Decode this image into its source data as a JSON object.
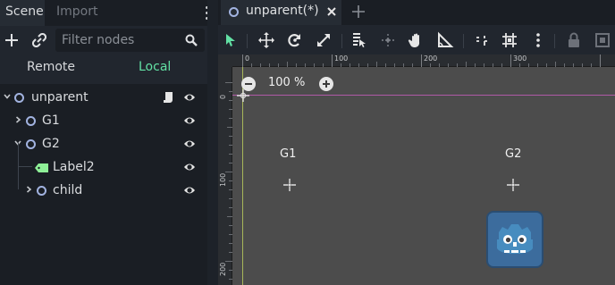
{
  "dock": {
    "tabs": [
      "Scene",
      "Import"
    ],
    "filter_placeholder": "Filter nodes",
    "remote_label": "Remote",
    "local_label": "Local",
    "tree": [
      {
        "label": "unparent",
        "icon": "node-ring-icon",
        "expanded": true,
        "has_script": true,
        "visible": true
      },
      {
        "label": "G1",
        "icon": "node-ring-icon",
        "expanded": false,
        "visible": true
      },
      {
        "label": "G2",
        "icon": "node-ring-icon",
        "expanded": true,
        "visible": true
      },
      {
        "label": "Label2",
        "icon": "label-node-icon",
        "visible": true
      },
      {
        "label": "child",
        "icon": "node-ring-icon",
        "expanded": false,
        "visible": true
      }
    ]
  },
  "editor": {
    "tab_title": "unparent(*)",
    "zoom": "100 %",
    "ruler_top": [
      "0",
      "100",
      "200",
      "300"
    ],
    "ruler_left": [
      "0",
      "100",
      "200"
    ],
    "nodes": [
      {
        "label": "G1"
      },
      {
        "label": "G2"
      }
    ]
  },
  "colors": {
    "accent": "#62e0a4",
    "node_ring": "#a2b3e0",
    "label_icon": "#8eef97",
    "x_axis": "#b05aa6",
    "y_axis": "#a7b85a"
  }
}
